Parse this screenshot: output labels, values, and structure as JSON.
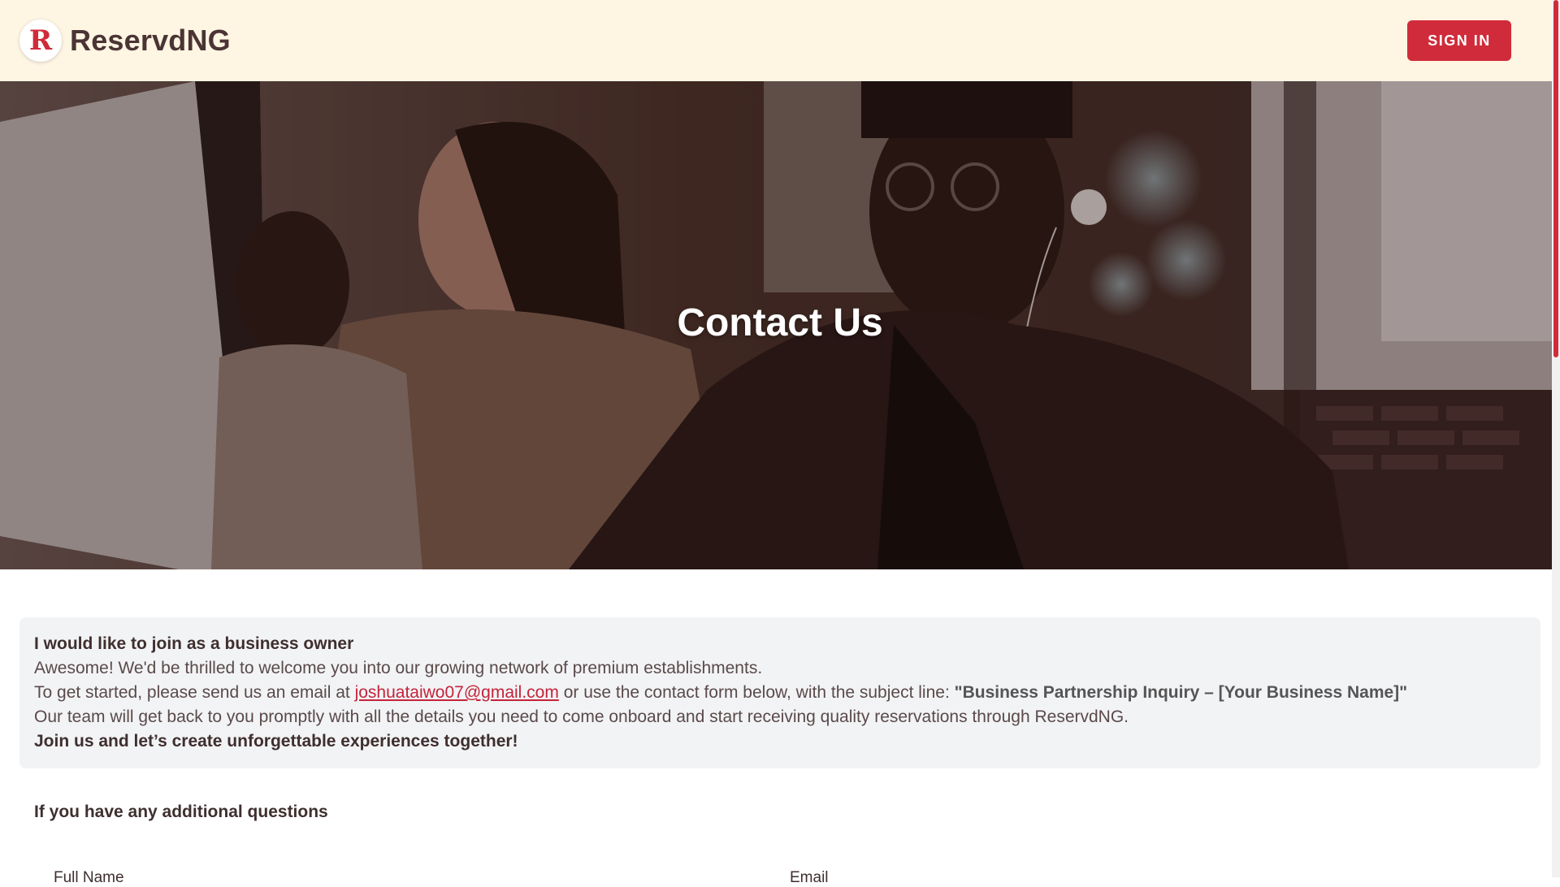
{
  "header": {
    "logo_letter": "R",
    "brand": "ReservdNG",
    "signin_label": "SIGN IN"
  },
  "hero": {
    "title": "Contact Us"
  },
  "info": {
    "heading": "I would like to join as a business owner",
    "line1": "Awesome! We'd be thrilled to welcome you into our growing network of premium establishments.",
    "line2_prefix": "To get started, please send us an email at ",
    "email": "joshuataiwo07@gmail.com",
    "line2_middle": " or use the contact form below, with the subject line: ",
    "subject": "\"Business Partnership Inquiry – [Your Business Name]\"",
    "line3": "Our team will get back to you promptly with all the details you need to come onboard and start receiving quality reservations through ReservdNG.",
    "line4": "Join us and let’s create unforgettable experiences together!"
  },
  "form": {
    "section_title": "If you have any additional questions",
    "full_name_label": "Full Name",
    "email_label": "Email"
  },
  "colors": {
    "accent": "#d02b3a",
    "header_bg": "#fef5e3",
    "info_bg": "#f2f3f5"
  }
}
